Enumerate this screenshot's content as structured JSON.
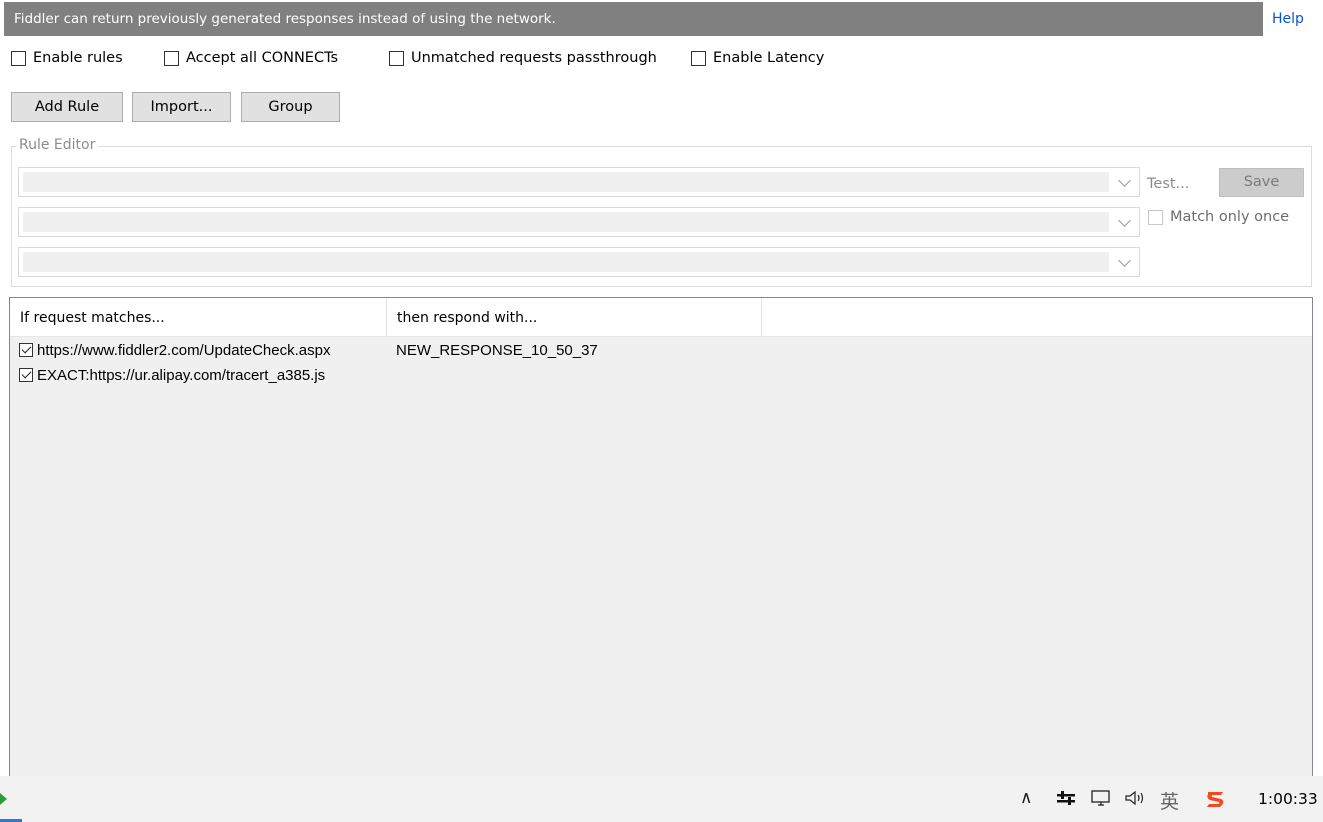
{
  "banner": {
    "text": "Fiddler can return previously generated responses instead of using the network.",
    "help": "Help"
  },
  "options": [
    {
      "label": "Enable rules",
      "checked": false
    },
    {
      "label": "Accept all CONNECTs",
      "checked": false
    },
    {
      "label": "Unmatched requests passthrough",
      "checked": false
    },
    {
      "label": "Enable Latency",
      "checked": false
    }
  ],
  "buttons": {
    "add_rule": "Add Rule",
    "import": "Import...",
    "group": "Group"
  },
  "rule_editor": {
    "title": "Rule Editor",
    "test": "Test...",
    "save": "Save",
    "match_once": "Match only once"
  },
  "list": {
    "columns": [
      "If request matches...",
      "then respond with..."
    ],
    "rows": [
      {
        "match": "https://www.fiddler2.com/UpdateCheck.aspx",
        "response": "NEW_RESPONSE_10_50_37",
        "checked": true
      },
      {
        "match": "EXACT:https://ur.alipay.com/tracert_a385.js",
        "response": "",
        "checked": true
      }
    ]
  },
  "taskbar": {
    "chevron": "∧",
    "input_method": "英",
    "clock": "1:00:33"
  }
}
